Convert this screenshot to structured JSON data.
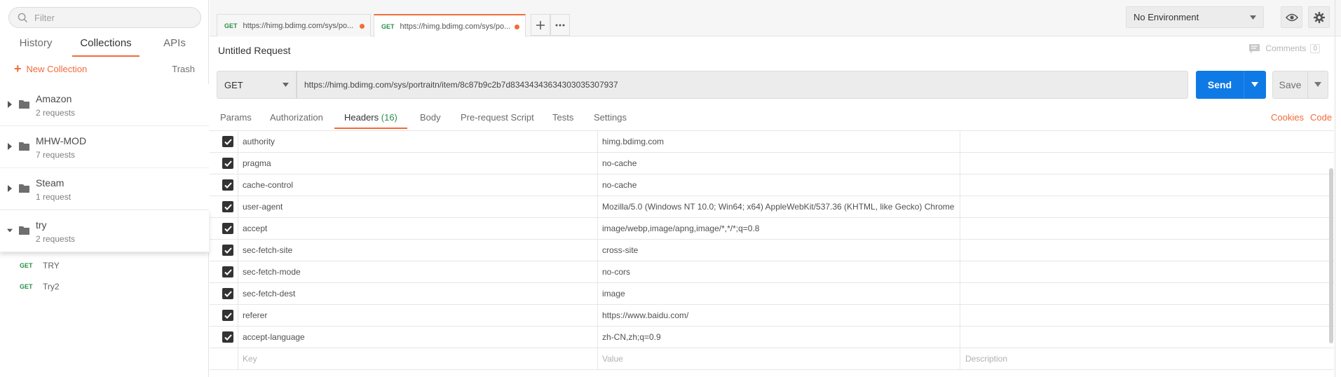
{
  "sidebar": {
    "filter_placeholder": "Filter",
    "tabs": [
      "History",
      "Collections",
      "APIs"
    ],
    "new_collection_label": "New Collection",
    "trash_label": "Trash",
    "collections": [
      {
        "name": "Amazon",
        "requests": "2 requests"
      },
      {
        "name": "MHW-MOD",
        "requests": "7 requests"
      },
      {
        "name": "Steam",
        "requests": "1 request"
      },
      {
        "name": "try",
        "requests": "2 requests"
      }
    ],
    "requests": [
      {
        "method": "GET",
        "name": "TRY"
      },
      {
        "method": "GET",
        "name": "Try2"
      }
    ]
  },
  "tabs": [
    {
      "method": "GET",
      "url": "https://himg.bdimg.com/sys/po..."
    },
    {
      "method": "GET",
      "url": "https://himg.bdimg.com/sys/po..."
    }
  ],
  "environment": "No Environment",
  "request": {
    "title": "Untitled Request",
    "comments_label": "Comments",
    "comments_count": "0",
    "method": "GET",
    "url": "https://himg.bdimg.com/sys/portraitn/item/8c87b9c2b7d834343436343030353079​37",
    "send_label": "Send",
    "save_label": "Save"
  },
  "subtabs": {
    "items": [
      "Params",
      "Authorization",
      "Headers",
      "Body",
      "Pre-request Script",
      "Tests",
      "Settings"
    ],
    "headers_count": "(16)",
    "cookies_label": "Cookies",
    "code_label": "Code"
  },
  "headers": [
    {
      "key": "authority",
      "value": "himg.bdimg.com"
    },
    {
      "key": "pragma",
      "value": "no-cache"
    },
    {
      "key": "cache-control",
      "value": "no-cache"
    },
    {
      "key": "user-agent",
      "value": "Mozilla/5.0 (Windows NT 10.0; Win64; x64) AppleWebKit/537.36 (KHTML, like Gecko) Chrome"
    },
    {
      "key": "accept",
      "value": "image/webp,image/apng,image/*,*/*;q=0.8"
    },
    {
      "key": "sec-fetch-site",
      "value": "cross-site"
    },
    {
      "key": "sec-fetch-mode",
      "value": "no-cors"
    },
    {
      "key": "sec-fetch-dest",
      "value": "image"
    },
    {
      "key": "referer",
      "value": "https://www.baidu.com/"
    },
    {
      "key": "accept-language",
      "value": "zh-CN,zh;q=0.9"
    }
  ],
  "header_placeholders": {
    "key": "Key",
    "value": "Value",
    "description": "Description"
  },
  "colors": {
    "accent": "#f26b3a",
    "send": "#0f7ae5",
    "get": "#2a8f4a"
  }
}
